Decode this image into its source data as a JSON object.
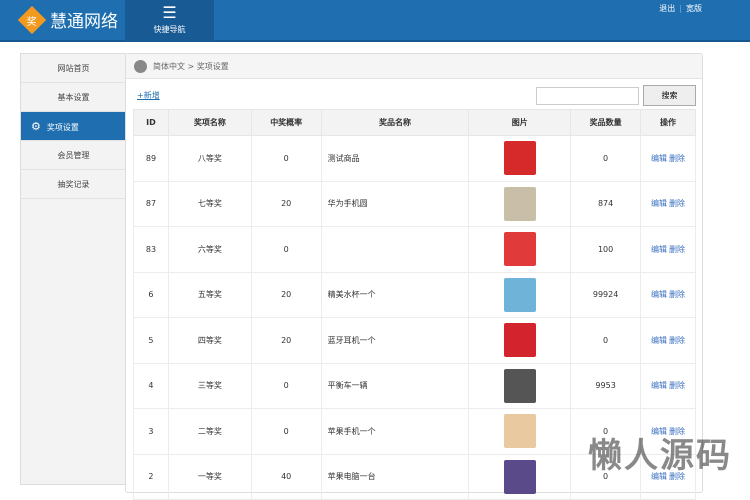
{
  "header": {
    "logo_badge": "奖",
    "title": "慧通网络",
    "quick_nav": "快捷导航",
    "links": [
      "退出",
      "宽版"
    ]
  },
  "sidebar": {
    "items": [
      "网站首页",
      "基本设置",
      "奖项设置",
      "会员管理",
      "抽奖记录"
    ],
    "active": 2
  },
  "breadcrumb": "简体中文 > 奖项设置",
  "toolbar": {
    "add": "+新增",
    "search_value": "",
    "search_button": "搜索"
  },
  "table": {
    "headers": [
      "ID",
      "奖项名称",
      "中奖概率",
      "奖品名称",
      "图片",
      "奖品数量",
      "操作"
    ],
    "rows": [
      {
        "id": "89",
        "prize": "八等奖",
        "rate": "0",
        "item": "测试商品",
        "img_color": "#d62a2a",
        "qty": "0"
      },
      {
        "id": "87",
        "prize": "七等奖",
        "rate": "20",
        "item": "华为手机圆",
        "img_color": "#c9bfa8",
        "qty": "874"
      },
      {
        "id": "83",
        "prize": "六等奖",
        "rate": "0",
        "item": "",
        "img_color": "#e03a3a",
        "qty": "100"
      },
      {
        "id": "6",
        "prize": "五等奖",
        "rate": "20",
        "item": "精美水杯一个",
        "img_color": "#6fb3d8",
        "qty": "99924"
      },
      {
        "id": "5",
        "prize": "四等奖",
        "rate": "20",
        "item": "蓝牙耳机一个",
        "img_color": "#d3232c",
        "qty": "0"
      },
      {
        "id": "4",
        "prize": "三等奖",
        "rate": "0",
        "item": "平衡车一辆",
        "img_color": "#555",
        "qty": "9953"
      },
      {
        "id": "3",
        "prize": "二等奖",
        "rate": "0",
        "item": "苹果手机一个",
        "img_color": "#e8c9a0",
        "qty": "0"
      },
      {
        "id": "2",
        "prize": "一等奖",
        "rate": "40",
        "item": "苹果电脑一台",
        "img_color": "#5a4a8a",
        "qty": "0"
      }
    ],
    "edit": "编辑",
    "delete": "删除"
  },
  "watermark": "懒人源码"
}
